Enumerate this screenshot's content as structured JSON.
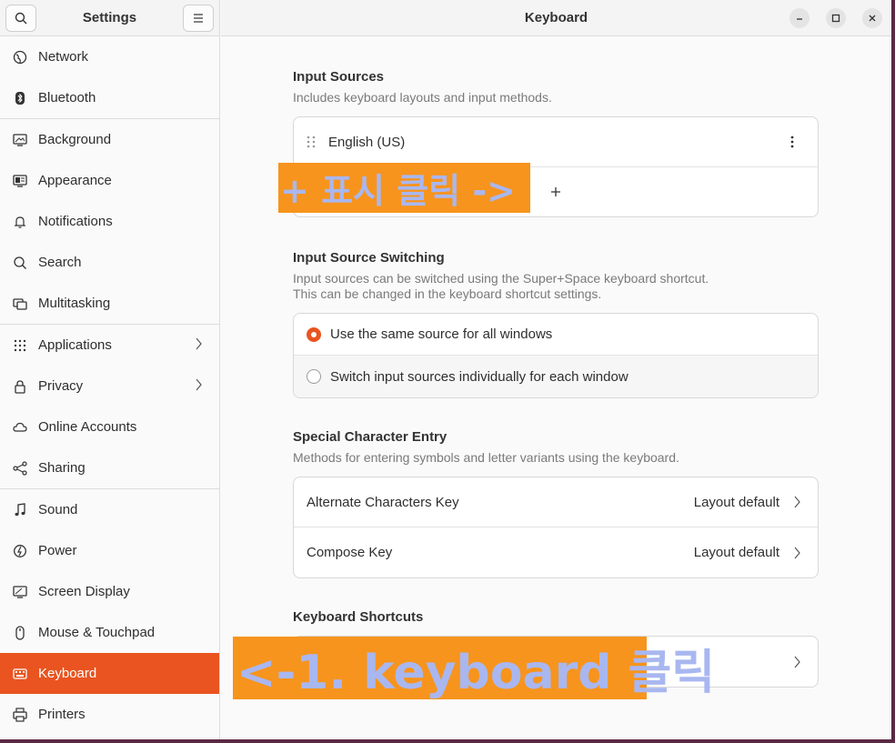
{
  "sidebar": {
    "title": "Settings",
    "search_icon": "search-icon",
    "menu_icon": "hamburger-menu-icon",
    "groups": [
      [
        {
          "label": "Network",
          "icon": "network-globe-icon"
        },
        {
          "label": "Bluetooth",
          "icon": "bluetooth-icon"
        }
      ],
      [
        {
          "label": "Background",
          "icon": "background-monitor-icon"
        },
        {
          "label": "Appearance",
          "icon": "appearance-icon"
        },
        {
          "label": "Notifications",
          "icon": "bell-icon"
        },
        {
          "label": "Search",
          "icon": "search-icon"
        },
        {
          "label": "Multitasking",
          "icon": "multitasking-icon"
        }
      ],
      [
        {
          "label": "Applications",
          "icon": "apps-grid-icon",
          "chevron": true
        },
        {
          "label": "Privacy",
          "icon": "lock-icon",
          "chevron": true
        },
        {
          "label": "Online Accounts",
          "icon": "cloud-icon"
        },
        {
          "label": "Sharing",
          "icon": "share-icon"
        }
      ],
      [
        {
          "label": "Sound",
          "icon": "music-note-icon"
        },
        {
          "label": "Power",
          "icon": "power-icon"
        },
        {
          "label": "Screen Display",
          "icon": "display-icon"
        },
        {
          "label": "Mouse & Touchpad",
          "icon": "mouse-icon"
        },
        {
          "label": "Keyboard",
          "icon": "keyboard-icon",
          "active": true
        },
        {
          "label": "Printers",
          "icon": "printer-icon"
        }
      ]
    ]
  },
  "header": {
    "title": "Keyboard"
  },
  "input_sources": {
    "title": "Input Sources",
    "description": "Includes keyboard layouts and input methods.",
    "sources": [
      "English (US)"
    ],
    "add_label": "+"
  },
  "switching": {
    "title": "Input Source Switching",
    "description_line1": "Input sources can be switched using the Super+Space keyboard shortcut.",
    "description_line2": "This can be changed in the keyboard shortcut settings.",
    "options": [
      {
        "label": "Use the same source for all windows",
        "selected": true
      },
      {
        "label": "Switch input sources individually for each window",
        "selected": false
      }
    ]
  },
  "special": {
    "title": "Special Character Entry",
    "description": "Methods for entering symbols and letter variants using the keyboard.",
    "rows": [
      {
        "label": "Alternate Characters Key",
        "value": "Layout default"
      },
      {
        "label": "Compose Key",
        "value": "Layout default"
      }
    ]
  },
  "shortcuts": {
    "title": "Keyboard Shortcuts"
  },
  "annotations": {
    "plus_hint": "+ 표시 클릭 ->",
    "keyboard_hint": "<-1. keyboard 클릭"
  },
  "colors": {
    "accent": "#e95420",
    "annotation_bg": "#f7941d",
    "annotation_text": "#a9b7f0"
  }
}
